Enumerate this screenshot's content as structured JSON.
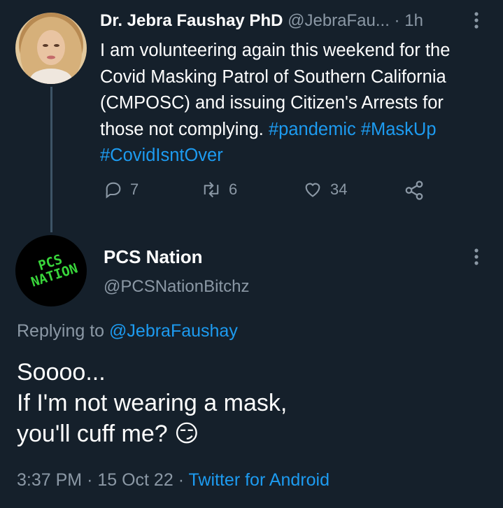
{
  "tweet1": {
    "display_name": "Dr. Jebra Faushay PhD",
    "handle": "@JebraFau...",
    "separator": "·",
    "time": "1h",
    "text_plain": "I am volunteering again this weekend for the Covid Masking Patrol of Southern California (CMPOSC) and issuing Citizen's Arrests for those not complying.",
    "hashtags": [
      "#pandemic",
      "#MaskUp",
      "#CovidIsntOver"
    ],
    "reply_count": "7",
    "retweet_count": "6",
    "like_count": "34"
  },
  "tweet2": {
    "display_name": "PCS Nation",
    "handle": "@PCSNationBitchz",
    "avatar_text": "PCS NATION",
    "replying_prefix": "Replying to",
    "replying_to": "@JebraFaushay",
    "line1": "Soooo...",
    "line2": "If I'm not wearing a mask,",
    "line3": "you'll cuff me?",
    "emoji": "😏",
    "time": "3:37 PM",
    "separator": "·",
    "date": "15 Oct 22",
    "source": "Twitter for Android"
  },
  "colors": {
    "background": "#15202b",
    "secondary_text": "#8b98a5",
    "accent": "#1d9bf0",
    "logo_green": "#39d53b"
  }
}
